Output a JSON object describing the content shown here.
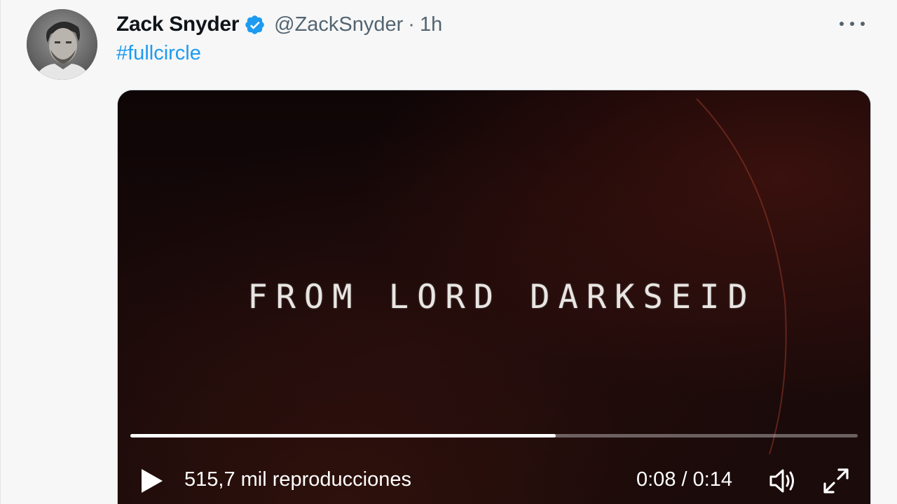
{
  "tweet": {
    "author": {
      "display_name": "Zack Snyder",
      "verified": true,
      "handle": "@ZackSnyder",
      "separator": "·",
      "time": "1h",
      "avatar_icon": "profile-photo"
    },
    "more_icon": "more-horizontal-icon",
    "text": "#fullcircle",
    "video": {
      "overlay_text": "FROM LORD DARKSEID",
      "progress_percent": 58.5,
      "views": "515,7 mil reproducciones",
      "timecode": "0:08 / 0:14",
      "icons": {
        "play": "play-icon",
        "volume": "volume-icon",
        "fullscreen": "fullscreen-icon"
      }
    }
  },
  "colors": {
    "link": "#1d9bf0",
    "verified_badge": "#1d9bf0",
    "secondary_text": "#536471",
    "primary_text": "#0f1419"
  }
}
